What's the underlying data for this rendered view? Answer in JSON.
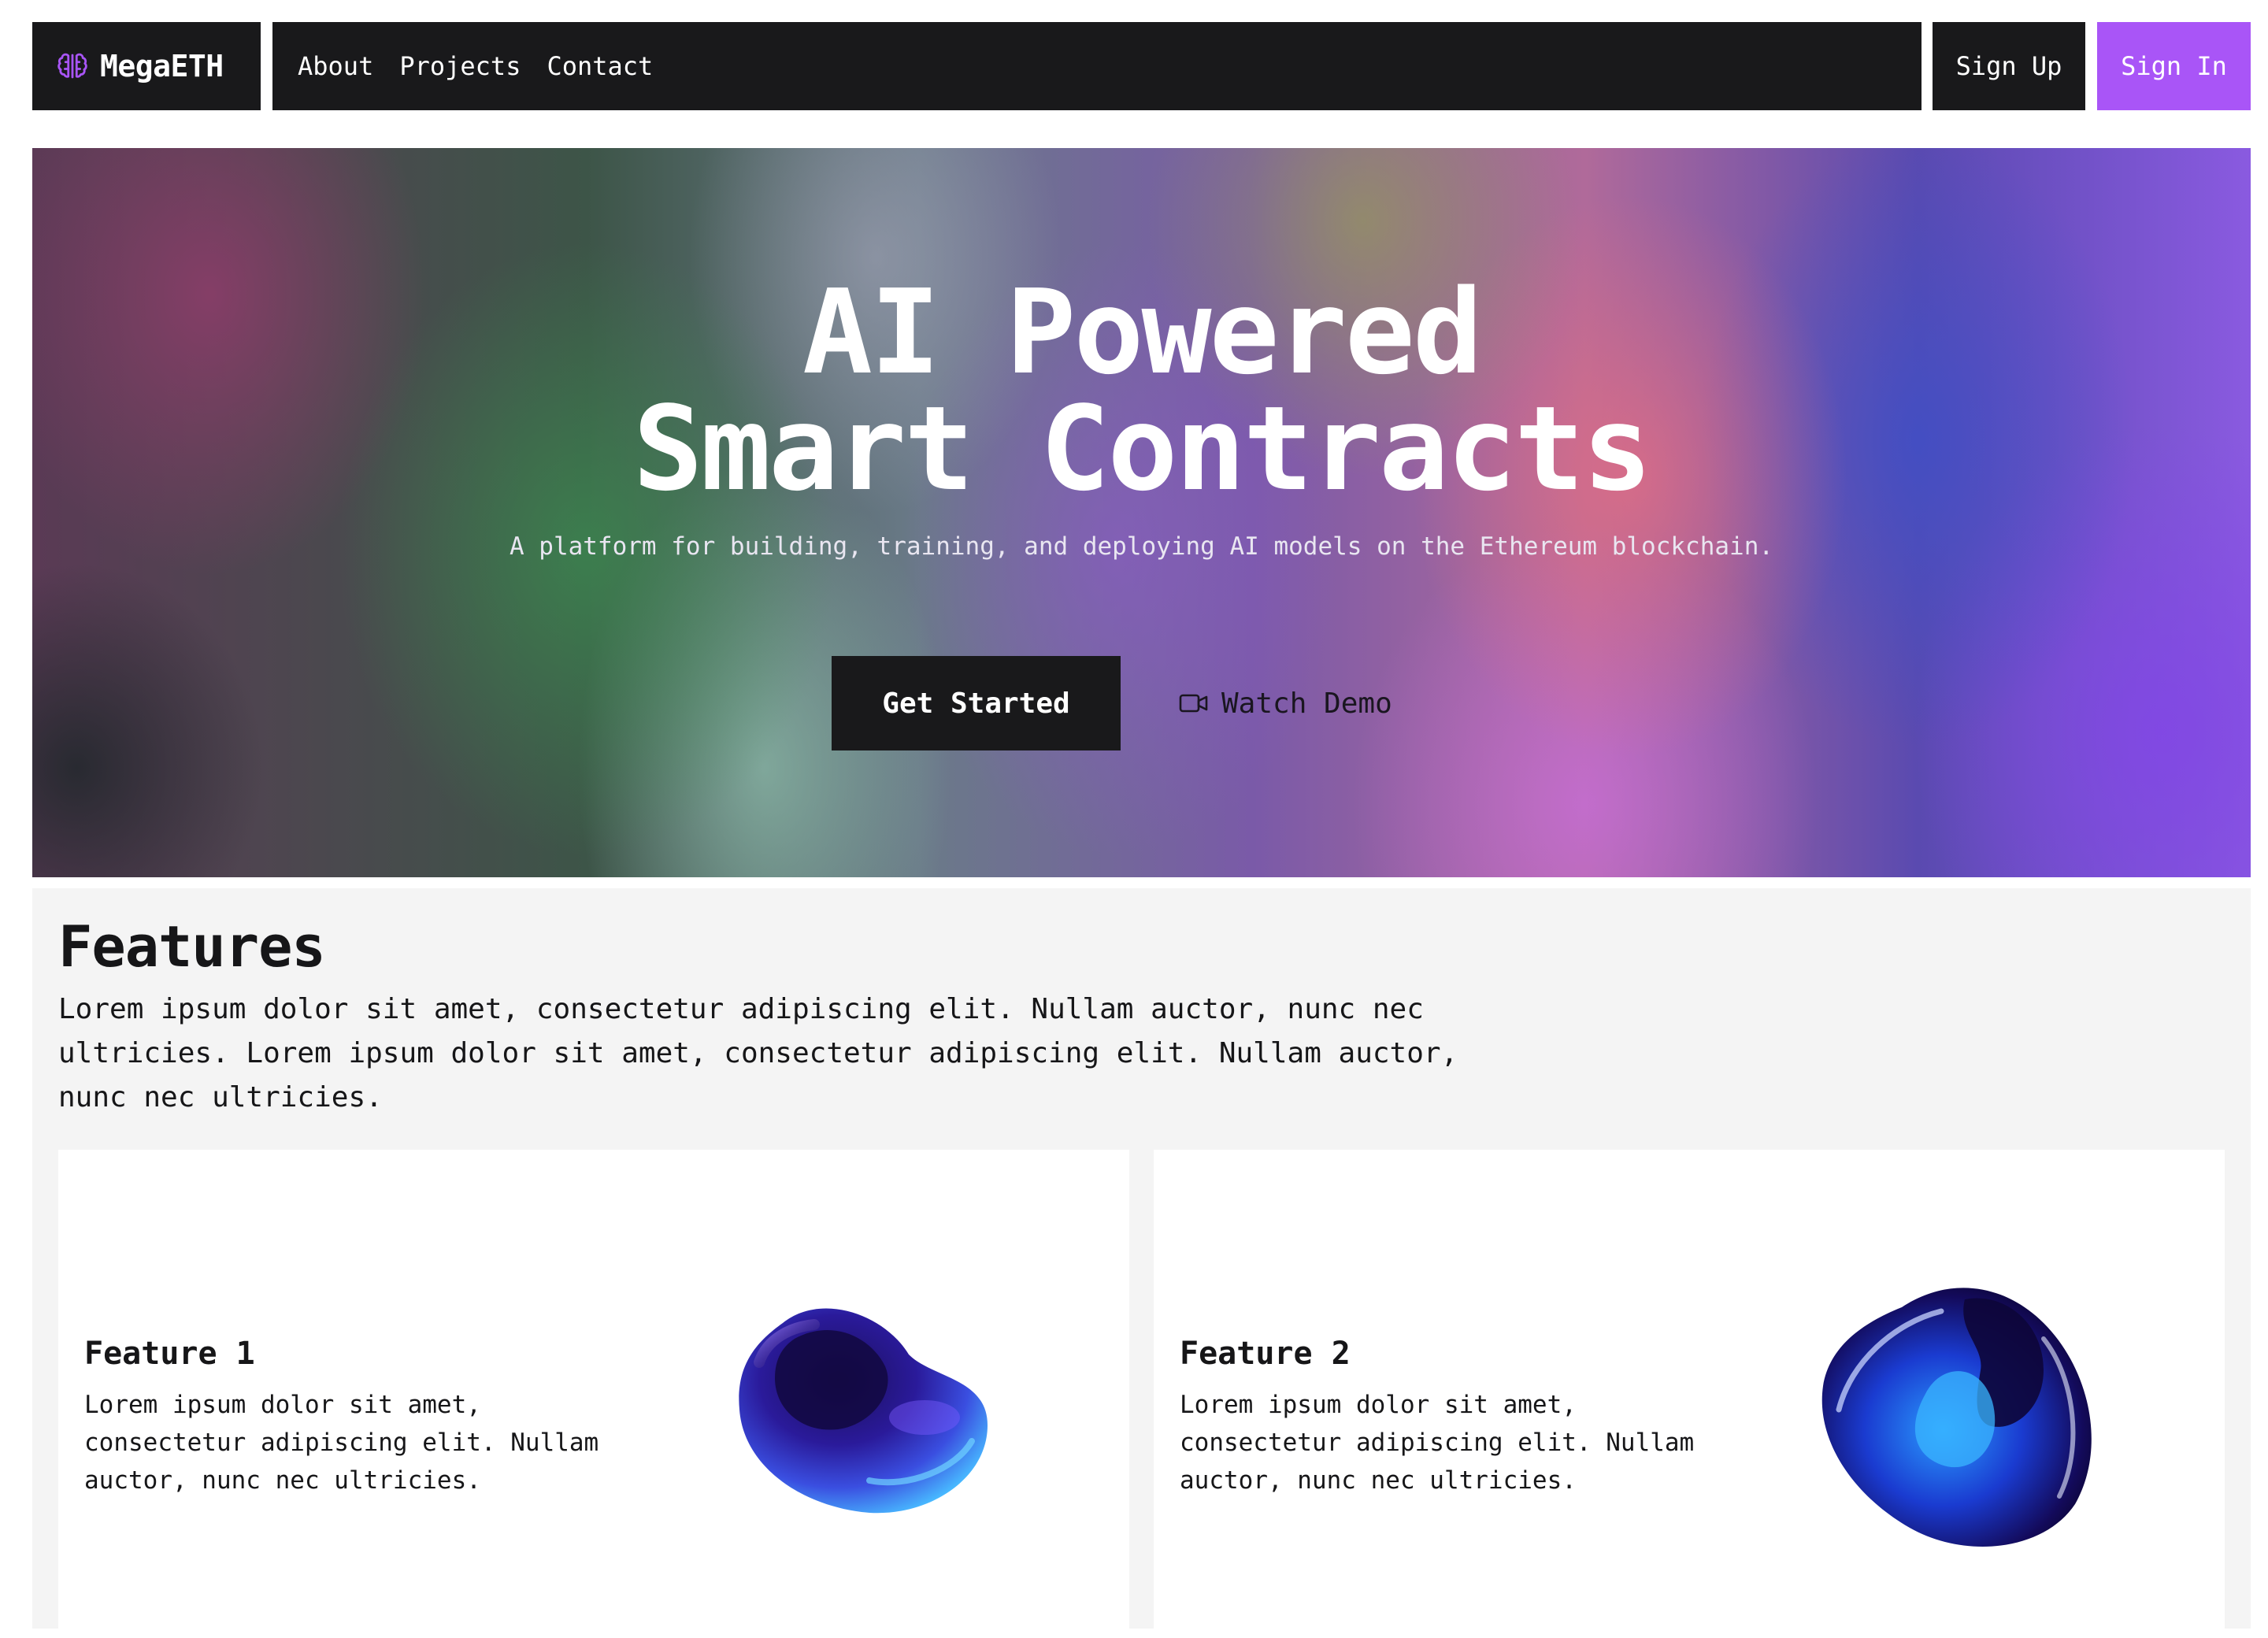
{
  "brand": {
    "name": "MegaETH",
    "logo_icon": "brain-icon"
  },
  "nav": {
    "links": [
      {
        "label": "About"
      },
      {
        "label": "Projects"
      },
      {
        "label": "Contact"
      }
    ],
    "sign_up": "Sign Up",
    "sign_in": "Sign In"
  },
  "hero": {
    "title_line1": "AI Powered",
    "title_line2": "Smart Contracts",
    "subtitle": "A platform for building, training, and deploying AI models on the Ethereum blockchain.",
    "cta_primary": "Get Started",
    "cta_secondary": "Watch Demo",
    "cta_secondary_icon": "video-camera-icon"
  },
  "features": {
    "title": "Features",
    "description": "Lorem ipsum dolor sit amet, consectetur adipiscing elit. Nullam auctor, nunc nec ultricies. Lorem ipsum dolor sit amet, consectetur adipiscing elit. Nullam auctor, nunc nec ultricies.",
    "cards": [
      {
        "title": "Feature 1",
        "text": "Lorem ipsum dolor sit amet, consectetur adipiscing elit. Nullam auctor, nunc nec ultricies."
      },
      {
        "title": "Feature 2",
        "text": "Lorem ipsum dolor sit amet, consectetur adipiscing elit. Nullam auctor, nunc nec ultricies."
      }
    ]
  },
  "colors": {
    "dark": "#19191b",
    "accent_purple": "#a955f7",
    "features_bg": "#f4f4f4"
  }
}
